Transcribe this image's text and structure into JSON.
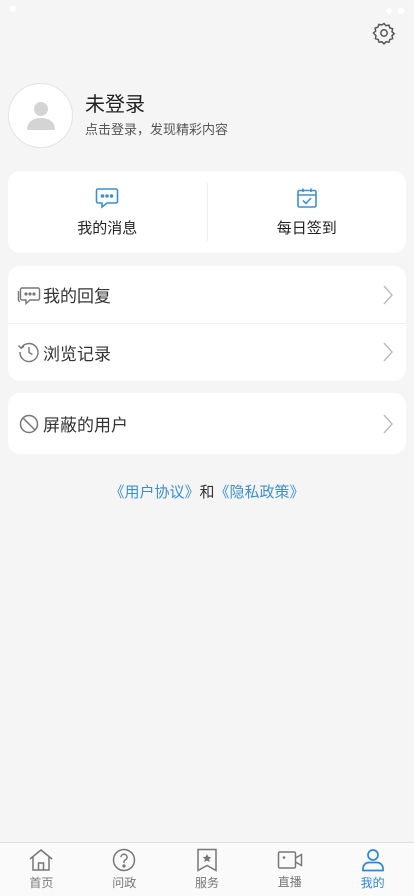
{
  "profile": {
    "name": "未登录",
    "subtitle": "点击登录，发现精彩内容"
  },
  "quick_actions": [
    {
      "label": "我的消息",
      "icon": "message-icon"
    },
    {
      "label": "每日签到",
      "icon": "calendar-check-icon"
    }
  ],
  "menu_group_1": [
    {
      "label": "我的回复",
      "icon": "reply-icon"
    },
    {
      "label": "浏览记录",
      "icon": "history-icon"
    }
  ],
  "menu_group_2": [
    {
      "label": "屏蔽的用户",
      "icon": "block-icon"
    }
  ],
  "agreement": {
    "user_agreement": "《用户协议》",
    "and": "和",
    "privacy_policy": "《隐私政策》"
  },
  "tabbar": {
    "active": "我的",
    "items": [
      {
        "label": "首页",
        "icon": "home-icon"
      },
      {
        "label": "问政",
        "icon": "question-icon"
      },
      {
        "label": "服务",
        "icon": "service-icon"
      },
      {
        "label": "直播",
        "icon": "video-icon"
      },
      {
        "label": "我的",
        "icon": "user-icon"
      }
    ]
  },
  "colors": {
    "accent": "#2b88d8",
    "link": "#3c8fd6",
    "background": "#f5f5f5"
  }
}
